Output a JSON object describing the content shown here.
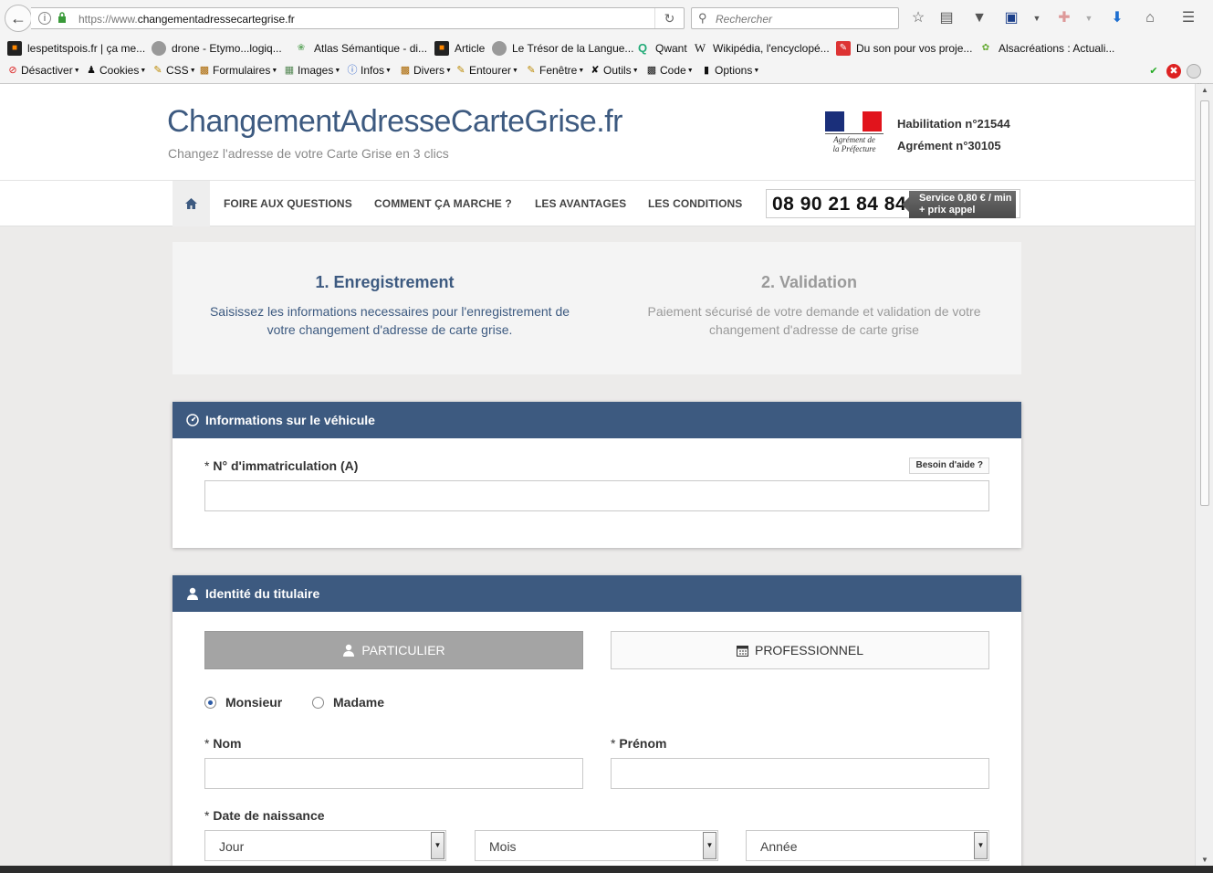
{
  "browser": {
    "url_protocol": "https://www.",
    "url_domain": "changementadressecartegrise.fr",
    "search_placeholder": "Rechercher",
    "bookmarks": [
      "lespetitspois.fr | ça me...",
      "drone - Etymo...logiq...",
      "Atlas Sémantique - di...",
      "Article",
      "Le Trésor de la Langue...",
      "Qwant",
      "Wikipédia, l'encyclopé...",
      "Du son pour vos proje...",
      "Alsacréations : Actuali..."
    ],
    "dev_toolbar": [
      "Désactiver",
      "Cookies",
      "CSS",
      "Formulaires",
      "Images",
      "Infos",
      "Divers",
      "Entourer",
      "Fenêtre",
      "Outils",
      "Code",
      "Options"
    ]
  },
  "site": {
    "title": "ChangementAdresseCarteGrise.fr",
    "subtitle": "Changez l'adresse de votre Carte Grise en 3 clics",
    "flag_caption_1": "Agrément de",
    "flag_caption_2": "la Préfecture",
    "habilitation": "Habilitation n°21544",
    "agrement": "Agrément n°30105"
  },
  "nav": {
    "items": [
      "FOIRE AUX QUESTIONS",
      "COMMENT ÇA MARCHE ?",
      "LES AVANTAGES",
      "LES CONDITIONS"
    ],
    "phone": "08 90 21 84 84",
    "phone_tag_1": "Service 0,80 € / min",
    "phone_tag_2": "+ prix appel"
  },
  "steps": [
    {
      "title": "1. Enregistrement",
      "desc": "Saisissez les informations necessaires pour l'enregistrement de votre changement d'adresse de carte grise."
    },
    {
      "title": "2. Validation",
      "desc": "Paiement sécurisé de votre demande et validation de votre changement d'adresse de carte grise"
    }
  ],
  "vehicle": {
    "heading": "Informations sur le véhicule",
    "plate_req": "*",
    "plate_label": "N° d'immatriculation (A)",
    "help": "Besoin d'aide ?",
    "plate_value": ""
  },
  "holder": {
    "heading": "Identité du titulaire",
    "particulier": "PARTICULIER",
    "professionnel": "PROFESSIONNEL",
    "monsieur": "Monsieur",
    "madame": "Madame",
    "req": "*",
    "nom": "Nom",
    "prenom": "Prénom",
    "birth": "Date de naissance",
    "jour": "Jour",
    "mois": "Mois",
    "annee": "Année"
  },
  "colors": {
    "brand_blue": "#3d5a80",
    "segment_active": "#a4a4a4"
  }
}
